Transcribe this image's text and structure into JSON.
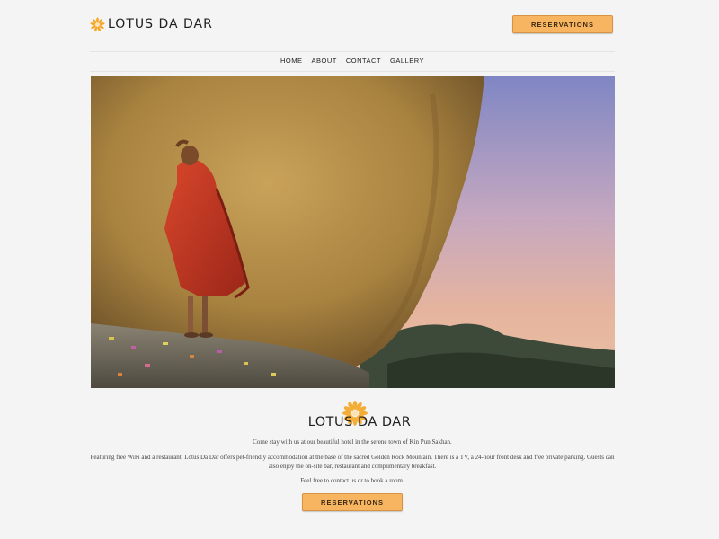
{
  "brand": {
    "name": "LOTUS DA DAR",
    "name_center": "LOTUS DA DAR",
    "accent_color": "#f7b461"
  },
  "header": {
    "reservations_label": "RESERVATIONS"
  },
  "nav": {
    "items": [
      {
        "label": "HOME"
      },
      {
        "label": "ABOUT"
      },
      {
        "label": "CONTACT"
      },
      {
        "label": "GALLERY"
      }
    ]
  },
  "hero": {
    "icon": "golden-rock-photo"
  },
  "content": {
    "line1": "Come stay with us at our beautiful hotel in the serene town of Kin Pun Sakhan.",
    "line2": "Featuring free WiFi and a restaurant, Lotus Da Dar offers pet-friendly accommodation at the base of the sacred Golden Rock Mountain. There is a TV, a 24-hour front desk and free private parking. Guests can also enjoy the on-site bar, restaurant and complimentary breakfast.",
    "line3": "Feel free to contact us or to book a room.",
    "reservations_label": "RESERVATIONS"
  }
}
